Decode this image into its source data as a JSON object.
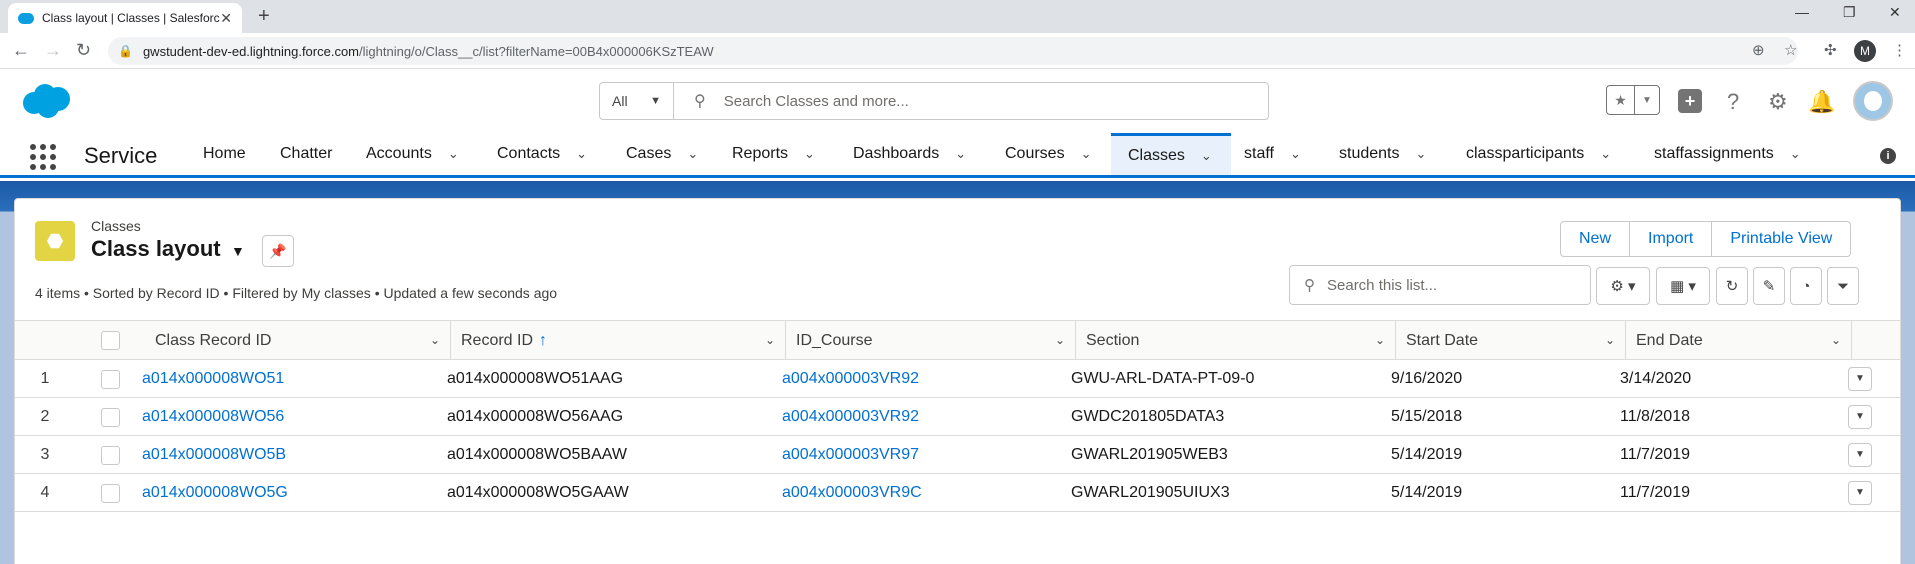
{
  "browser": {
    "tab_title": "Class layout | Classes | Salesforce",
    "url_host": "gwstudent-dev-ed.lightning.force.com",
    "url_path": "/lightning/o/Class__c/list?filterName=00B4x000006KSzTEAW",
    "profile_initial": "M"
  },
  "header": {
    "search_scope": "All",
    "search_placeholder": "Search Classes and more..."
  },
  "nav": {
    "app_name": "Service",
    "items": [
      {
        "label": "Home"
      },
      {
        "label": "Chatter"
      },
      {
        "label": "Accounts"
      },
      {
        "label": "Contacts"
      },
      {
        "label": "Cases"
      },
      {
        "label": "Reports"
      },
      {
        "label": "Dashboards"
      },
      {
        "label": "Courses"
      },
      {
        "label": "Classes"
      },
      {
        "label": "staff"
      },
      {
        "label": "students"
      },
      {
        "label": "classparticipants"
      },
      {
        "label": "staffassignments"
      }
    ]
  },
  "listview": {
    "object_label": "Classes",
    "view_name": "Class layout",
    "summary": "4 items • Sorted by Record ID • Filtered by My classes • Updated a few seconds ago",
    "buttons": {
      "new": "New",
      "import": "Import",
      "printable": "Printable View"
    },
    "search_placeholder": "Search this list...",
    "columns": [
      "Class Record ID",
      "Record ID",
      "ID_Course",
      "Section",
      "Start Date",
      "End Date"
    ],
    "rows": [
      {
        "num": "1",
        "class_record_id": "a014x000008WO51",
        "record_id": "a014x000008WO51AAG",
        "id_course": "a004x000003VR92",
        "section": "GWU-ARL-DATA-PT-09-0",
        "start": "9/16/2020",
        "end": "3/14/2020"
      },
      {
        "num": "2",
        "class_record_id": "a014x000008WO56",
        "record_id": "a014x000008WO56AAG",
        "id_course": "a004x000003VR92",
        "section": "GWDC201805DATA3",
        "start": "5/15/2018",
        "end": "11/8/2018"
      },
      {
        "num": "3",
        "class_record_id": "a014x000008WO5B",
        "record_id": "a014x000008WO5BAAW",
        "id_course": "a004x000003VR97",
        "section": "GWARL201905WEB3",
        "start": "5/14/2019",
        "end": "11/7/2019"
      },
      {
        "num": "4",
        "class_record_id": "a014x000008WO5G",
        "record_id": "a014x000008WO5GAAW",
        "id_course": "a004x000003VR9C",
        "section": "GWARL201905UIUX3",
        "start": "5/14/2019",
        "end": "11/7/2019"
      }
    ]
  }
}
